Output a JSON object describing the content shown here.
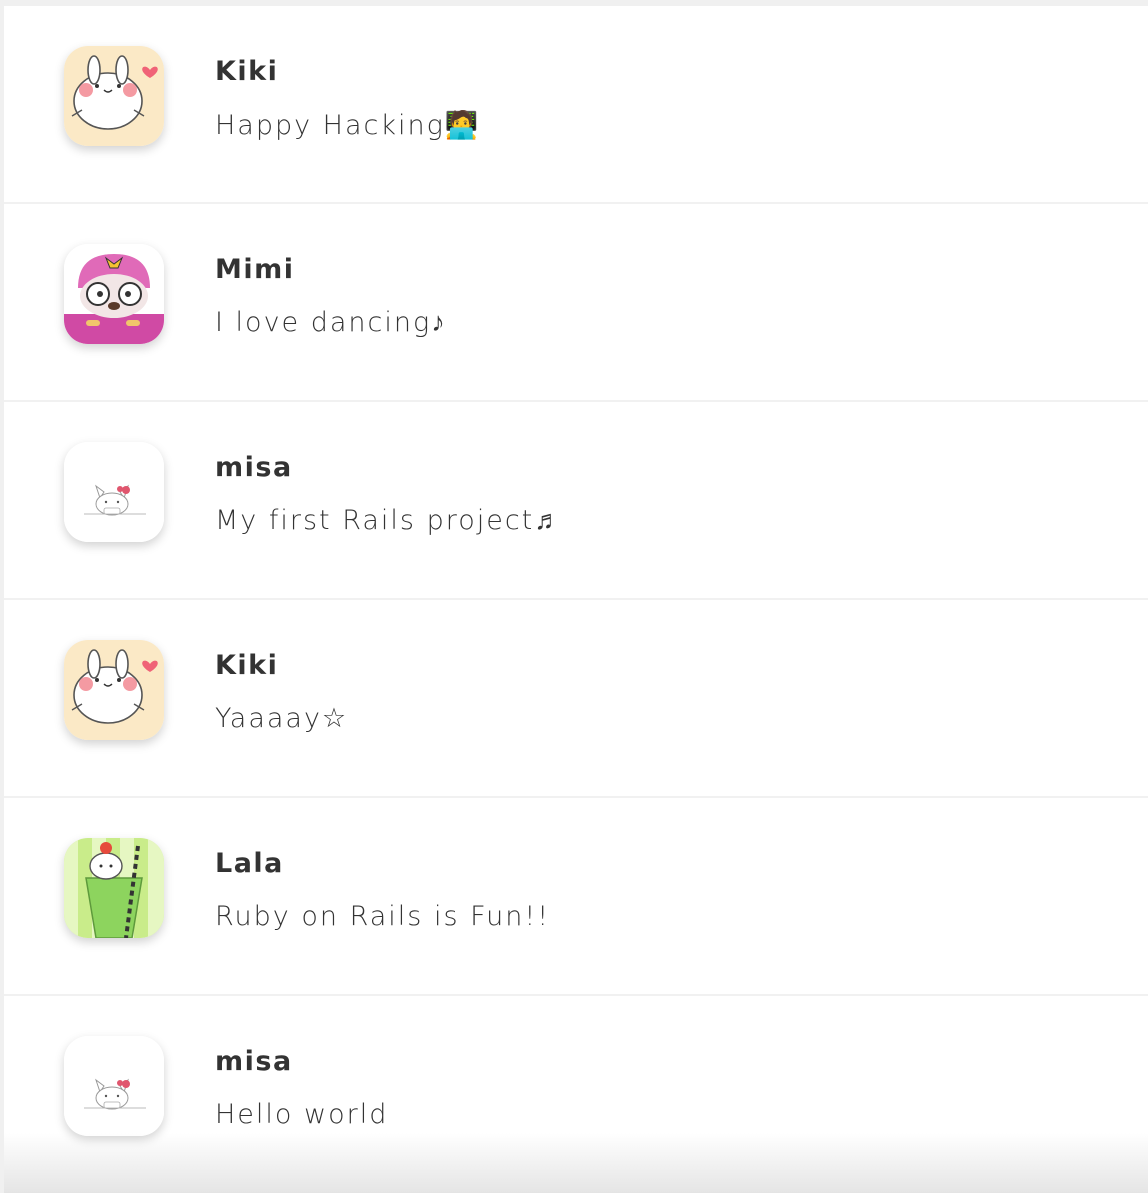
{
  "posts": [
    {
      "user": "Kiki",
      "content": "Happy Hacking🧑‍💻",
      "avatar": "bunny-heart-avatar"
    },
    {
      "user": "Mimi",
      "content": "I love dancing♪",
      "avatar": "pink-hair-gopher-avatar"
    },
    {
      "user": "misa",
      "content": "My first Rails project♬",
      "avatar": "cat-bow-avatar"
    },
    {
      "user": "Kiki",
      "content": "Yaaaay☆",
      "avatar": "bunny-heart-avatar"
    },
    {
      "user": "Lala",
      "content": "Ruby on Rails is Fun!!",
      "avatar": "bunny-melon-soda-avatar"
    },
    {
      "user": "misa",
      "content": "Hello world",
      "avatar": "cat-bow-avatar"
    }
  ],
  "colors": {
    "text": "#333333",
    "divider": "#f1f1f1",
    "background": "#ffffff",
    "avatar_bunny_bg": "#fbe9c6",
    "avatar_gopher_bg": "#d04aa4",
    "avatar_soda_bg": "#c9ec8a"
  }
}
